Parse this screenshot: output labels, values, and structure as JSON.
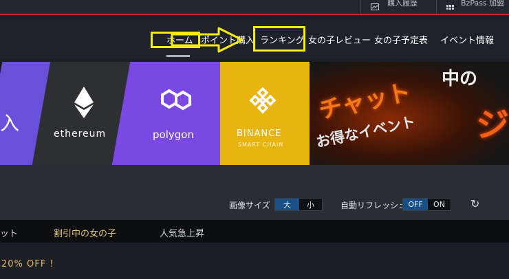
{
  "topbar": {
    "history_label": "購入履歴",
    "bzpass_label": "BzPass 加盟"
  },
  "nav": {
    "items": [
      "ホーム",
      "ポイント購入",
      "ランキング",
      "女の子レビュー",
      "女の子予定表",
      "イベント情報"
    ],
    "active": "ホーム"
  },
  "banner": {
    "left_fragment": "入",
    "ethereum": "ethereum",
    "polygon": "polygon",
    "binance": "BINANCE",
    "binance_sub": "SMART CHAIN",
    "event_line1": "チャット",
    "event_line2": "中の",
    "event_line3": "お得なイベント",
    "event_line4": "ジ"
  },
  "controls": {
    "image_size_label": "画像サイズ",
    "size_large": "大",
    "size_small": "小",
    "auto_refresh_label": "自動リフレッシュ",
    "refresh_off": "OFF",
    "refresh_on": "ON"
  },
  "tabs": {
    "items": [
      "ット",
      "割引中の女の子",
      "人気急上昇"
    ],
    "active_color": "#e9c37a"
  },
  "content": {
    "sale_text": "20% OFF !"
  },
  "colors": {
    "highlight": "#f5ee0c",
    "accent_red": "#c1272d"
  }
}
